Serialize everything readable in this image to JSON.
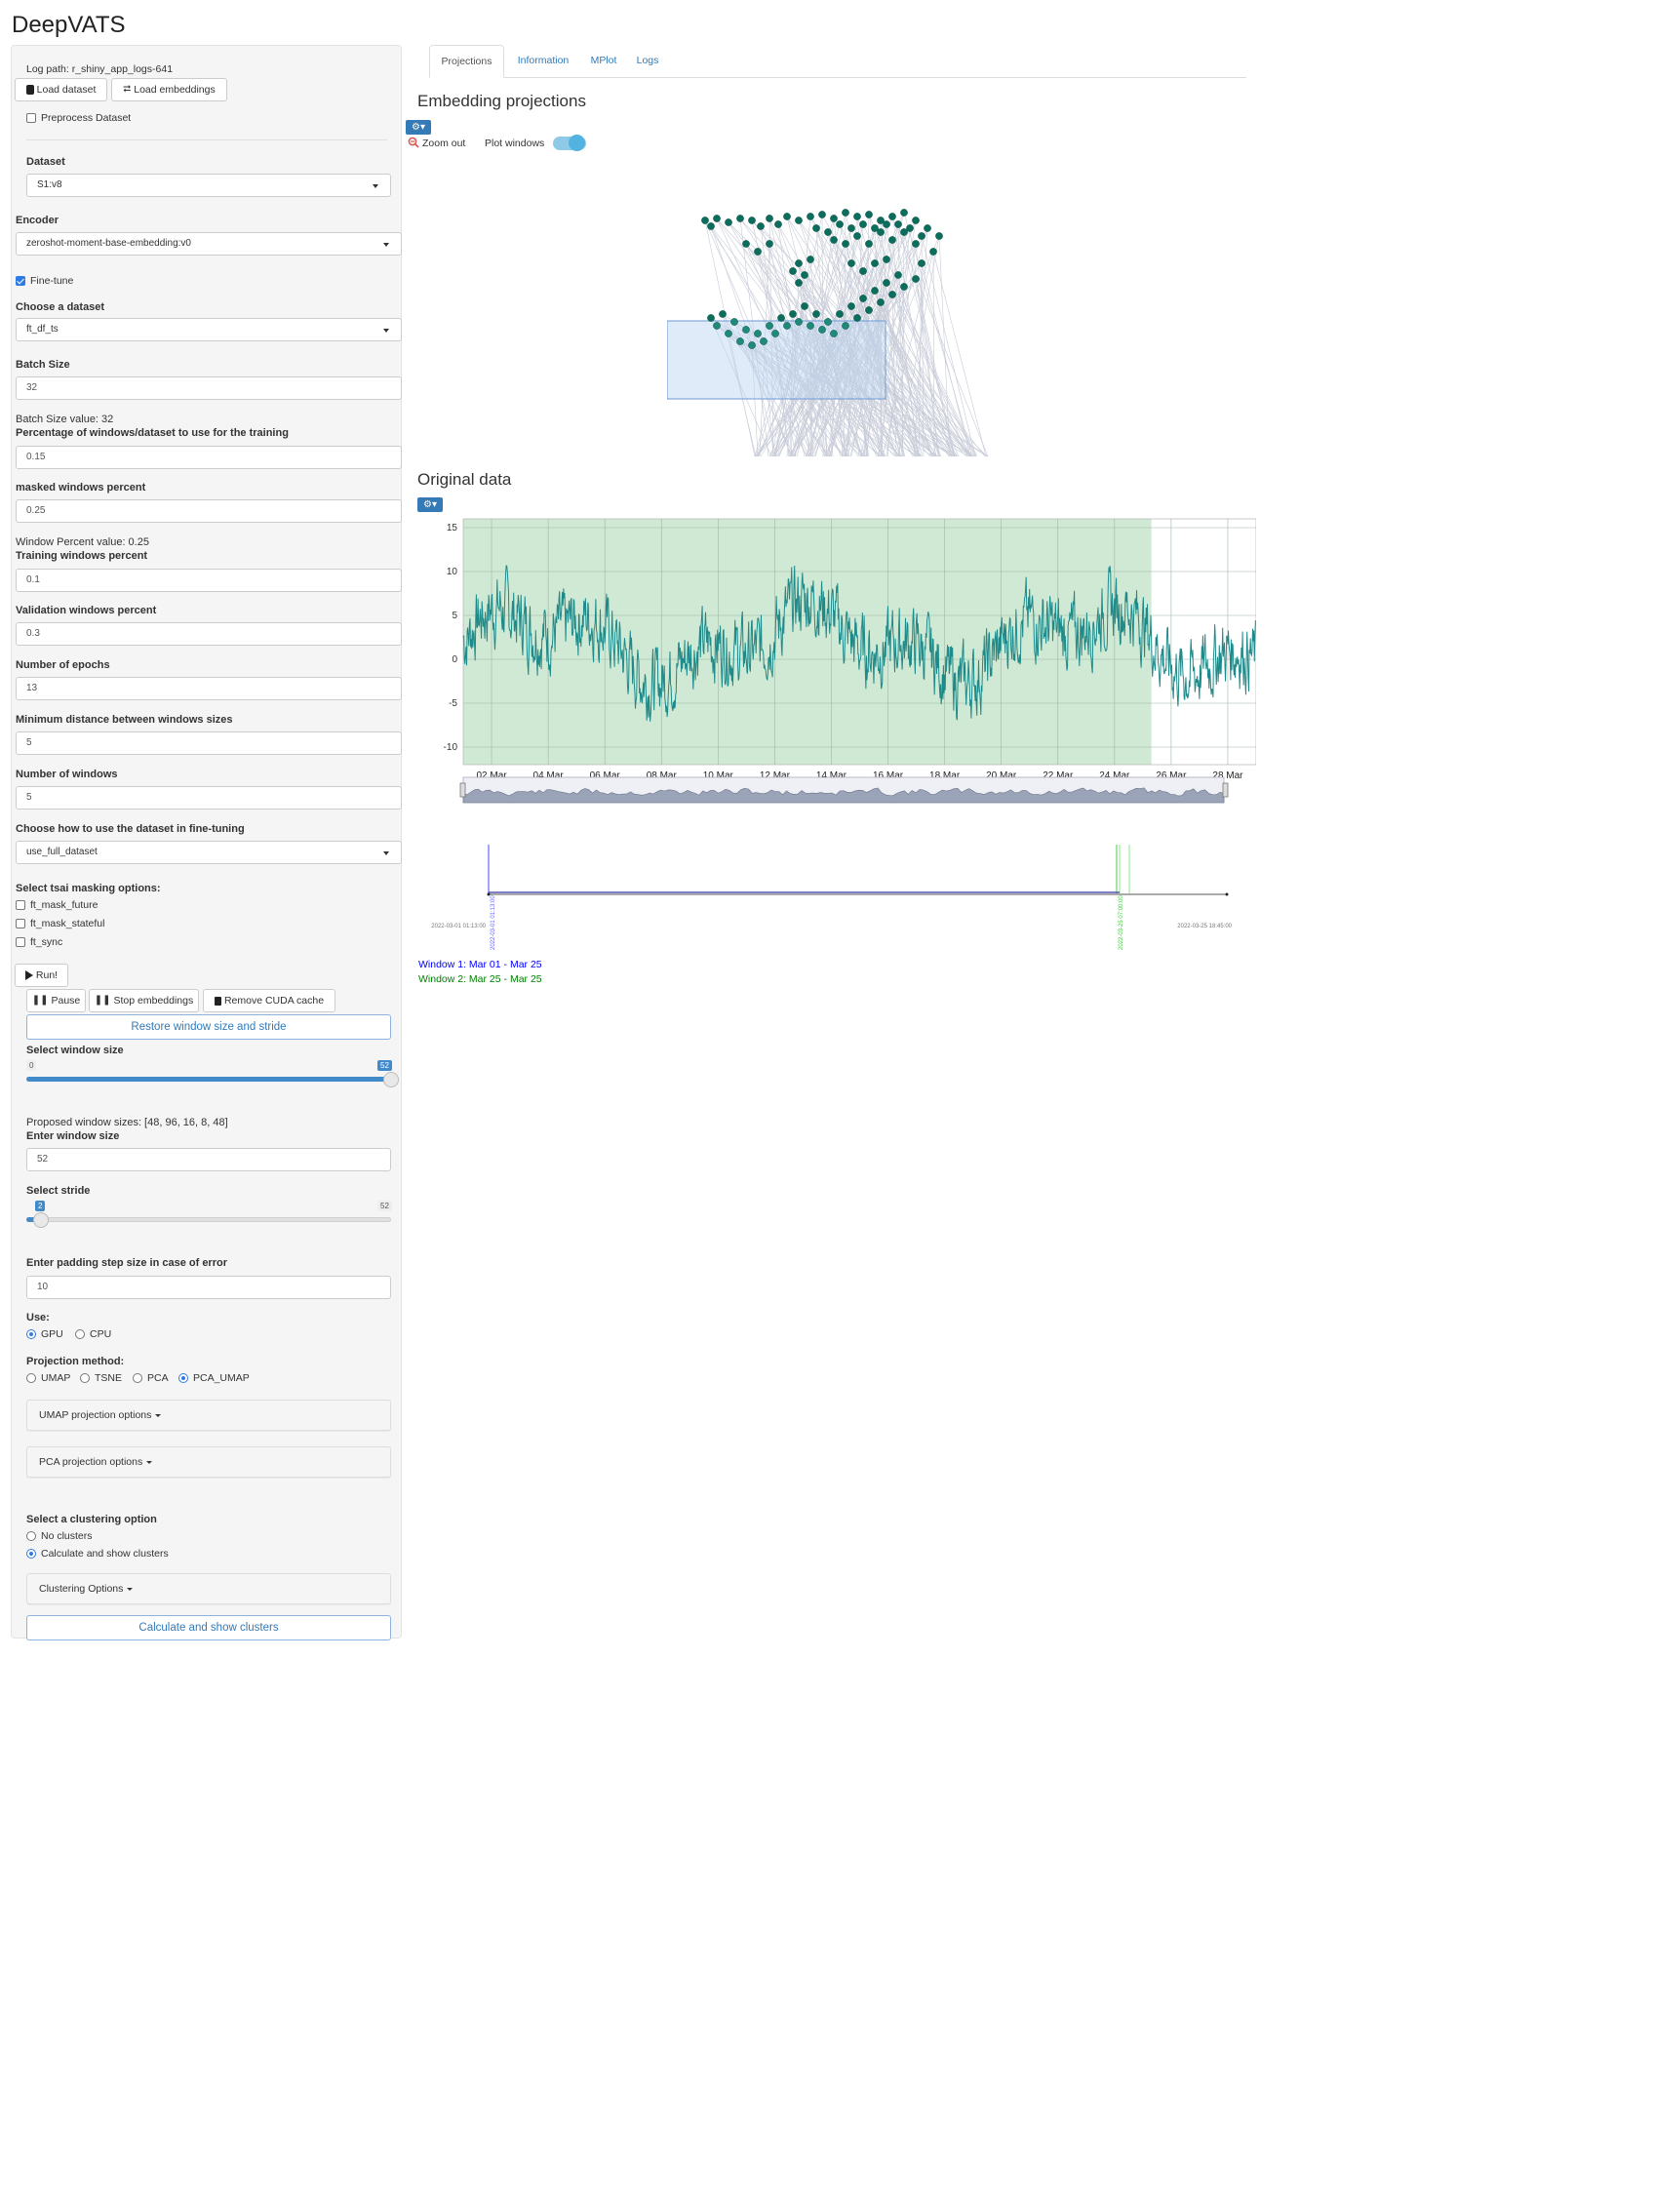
{
  "app": {
    "title": "DeepVATS"
  },
  "sidebar": {
    "log_path": "Log path: r_shiny_app_logs-641",
    "load_dataset": "Load dataset",
    "load_embeddings": "Load embeddings",
    "preprocess": "Preprocess Dataset",
    "dataset_label": "Dataset",
    "dataset_value": "S1:v8",
    "encoder_label": "Encoder",
    "encoder_value": "zeroshot-moment-base-embedding:v0",
    "finetune_label": "Fine-tune",
    "choose_dataset_label": "Choose a dataset",
    "choose_dataset_value": "ft_df_ts",
    "batch_size_label": "Batch Size",
    "batch_size_value": "32",
    "batch_size_info": "Batch Size value: 32",
    "pct_windows_label": "Percentage of windows/dataset to use for the training",
    "pct_windows_value": "0.15",
    "masked_label": "masked windows percent",
    "masked_value": "0.25",
    "window_pct_info": "Window Percent value: 0.25",
    "training_label": "Training windows percent",
    "training_value": "0.1",
    "validation_label": "Validation windows percent",
    "validation_value": "0.3",
    "epochs_label": "Number of epochs",
    "epochs_value": "13",
    "min_dist_label": "Minimum distance between windows sizes",
    "min_dist_value": "5",
    "num_windows_label": "Number of windows",
    "num_windows_value": "5",
    "use_dataset_label": "Choose how to use the dataset in fine-tuning",
    "use_dataset_value": "use_full_dataset",
    "masking_label": "Select tsai masking options:",
    "mask_future": "ft_mask_future",
    "mask_stateful": "ft_mask_stateful",
    "mask_sync": "ft_sync",
    "run": "Run!",
    "pause": "Pause",
    "stop_embeddings": "Stop embeddings",
    "remove_cuda": "Remove CUDA cache",
    "restore": "Restore window size and stride",
    "window_size_label": "Select window size",
    "window_size_min": "0",
    "window_size_max": "52",
    "window_size_value": "52",
    "window_size_fraction": 1.0,
    "proposed_sizes": "Proposed window sizes: [48, 96, 16, 8, 48]",
    "enter_window_label": "Enter window size",
    "enter_window_value": "52",
    "stride_label": "Select stride",
    "stride_value": "2",
    "stride_max": "52",
    "stride_fraction": 0.04,
    "padding_label": "Enter padding step size in case of error",
    "padding_value": "10",
    "use_label": "Use:",
    "gpu": "GPU",
    "cpu": "CPU",
    "projection_label": "Projection method:",
    "umap": "UMAP",
    "tsne": "TSNE",
    "pca": "PCA",
    "pca_umap": "PCA_UMAP",
    "umap_options": "UMAP projection options",
    "pca_options": "PCA projection options",
    "clustering_label": "Select a clustering option",
    "no_clusters": "No clusters",
    "calc_clusters": "Calculate and show clusters",
    "clustering_options": "Clustering Options",
    "calc_button": "Calculate and show clusters"
  },
  "tabs": [
    "Projections",
    "Information",
    "MPlot",
    "Logs"
  ],
  "main": {
    "embedding_title": "Embedding projections",
    "zoom_out": "Zoom out",
    "plot_windows": "Plot windows",
    "original_title": "Original data",
    "timeline_start": "2022-03-01 01:13:00",
    "timeline_end": "2022-03-25 18:45:00",
    "timeline_w1_label": "2022-03-01 01:13:00",
    "timeline_w2_label": "2022-03-25 07:00:00",
    "window1": "Window 1: Mar 01 - Mar 25",
    "window2": "Window 2: Mar 25 - Mar 25"
  },
  "colors": {
    "accent": "#337ab7",
    "point": "#0b6e5c",
    "series": "#1f8a8a",
    "highlight": "#cfe9d4",
    "window1": "#0000ff",
    "window2": "#008000"
  },
  "chart_data": [
    {
      "type": "scatter",
      "description_points": "UMAP embedding points with connecting lines; selection rectangle over lower-left cluster",
      "points": [
        [
          0.08,
          0.08
        ],
        [
          0.1,
          0.11
        ],
        [
          0.12,
          0.07
        ],
        [
          0.16,
          0.09
        ],
        [
          0.2,
          0.07
        ],
        [
          0.24,
          0.08
        ],
        [
          0.27,
          0.11
        ],
        [
          0.3,
          0.07
        ],
        [
          0.33,
          0.1
        ],
        [
          0.36,
          0.06
        ],
        [
          0.4,
          0.08
        ],
        [
          0.44,
          0.06
        ],
        [
          0.48,
          0.05
        ],
        [
          0.52,
          0.07
        ],
        [
          0.56,
          0.04
        ],
        [
          0.6,
          0.06
        ],
        [
          0.64,
          0.05
        ],
        [
          0.68,
          0.08
        ],
        [
          0.72,
          0.06
        ],
        [
          0.76,
          0.04
        ],
        [
          0.8,
          0.08
        ],
        [
          0.84,
          0.12
        ],
        [
          0.88,
          0.16
        ],
        [
          0.86,
          0.24
        ],
        [
          0.82,
          0.3
        ],
        [
          0.8,
          0.38
        ],
        [
          0.76,
          0.42
        ],
        [
          0.72,
          0.46
        ],
        [
          0.68,
          0.5
        ],
        [
          0.64,
          0.54
        ],
        [
          0.6,
          0.58
        ],
        [
          0.56,
          0.62
        ],
        [
          0.52,
          0.66
        ],
        [
          0.48,
          0.64
        ],
        [
          0.44,
          0.62
        ],
        [
          0.4,
          0.6
        ],
        [
          0.36,
          0.62
        ],
        [
          0.32,
          0.66
        ],
        [
          0.28,
          0.7
        ],
        [
          0.24,
          0.72
        ],
        [
          0.2,
          0.7
        ],
        [
          0.16,
          0.66
        ],
        [
          0.12,
          0.62
        ],
        [
          0.1,
          0.58
        ],
        [
          0.14,
          0.56
        ],
        [
          0.18,
          0.6
        ],
        [
          0.22,
          0.64
        ],
        [
          0.26,
          0.66
        ],
        [
          0.3,
          0.62
        ],
        [
          0.34,
          0.58
        ],
        [
          0.38,
          0.56
        ],
        [
          0.42,
          0.52
        ],
        [
          0.46,
          0.56
        ],
        [
          0.5,
          0.6
        ],
        [
          0.54,
          0.56
        ],
        [
          0.58,
          0.52
        ],
        [
          0.62,
          0.48
        ],
        [
          0.66,
          0.44
        ],
        [
          0.7,
          0.4
        ],
        [
          0.74,
          0.36
        ],
        [
          0.4,
          0.3
        ],
        [
          0.38,
          0.34
        ],
        [
          0.42,
          0.36
        ],
        [
          0.4,
          0.4
        ],
        [
          0.44,
          0.28
        ],
        [
          0.3,
          0.2
        ],
        [
          0.26,
          0.24
        ],
        [
          0.22,
          0.2
        ],
        [
          0.52,
          0.18
        ],
        [
          0.56,
          0.2
        ],
        [
          0.6,
          0.16
        ],
        [
          0.64,
          0.2
        ],
        [
          0.68,
          0.14
        ],
        [
          0.72,
          0.18
        ],
        [
          0.76,
          0.14
        ],
        [
          0.8,
          0.2
        ],
        [
          0.62,
          0.34
        ],
        [
          0.66,
          0.3
        ],
        [
          0.7,
          0.28
        ],
        [
          0.58,
          0.3
        ],
        [
          0.46,
          0.12
        ],
        [
          0.5,
          0.14
        ],
        [
          0.54,
          0.1
        ],
        [
          0.58,
          0.12
        ],
        [
          0.62,
          0.1
        ],
        [
          0.66,
          0.12
        ],
        [
          0.7,
          0.1
        ],
        [
          0.74,
          0.1
        ],
        [
          0.78,
          0.12
        ],
        [
          0.82,
          0.16
        ]
      ]
    },
    {
      "type": "line",
      "title": "Original data",
      "x_ticks": [
        "02 Mar",
        "04 Mar",
        "06 Mar",
        "08 Mar",
        "10 Mar",
        "12 Mar",
        "14 Mar",
        "16 Mar",
        "18 Mar",
        "20 Mar",
        "22 Mar",
        "24 Mar",
        "26 Mar",
        "28 Mar"
      ],
      "y_ticks": [
        15,
        10,
        5,
        0,
        -5,
        -10
      ],
      "ylim": [
        -12,
        16
      ],
      "highlight_range": [
        "Mar 01",
        "Mar 25"
      ],
      "grid": true
    }
  ]
}
